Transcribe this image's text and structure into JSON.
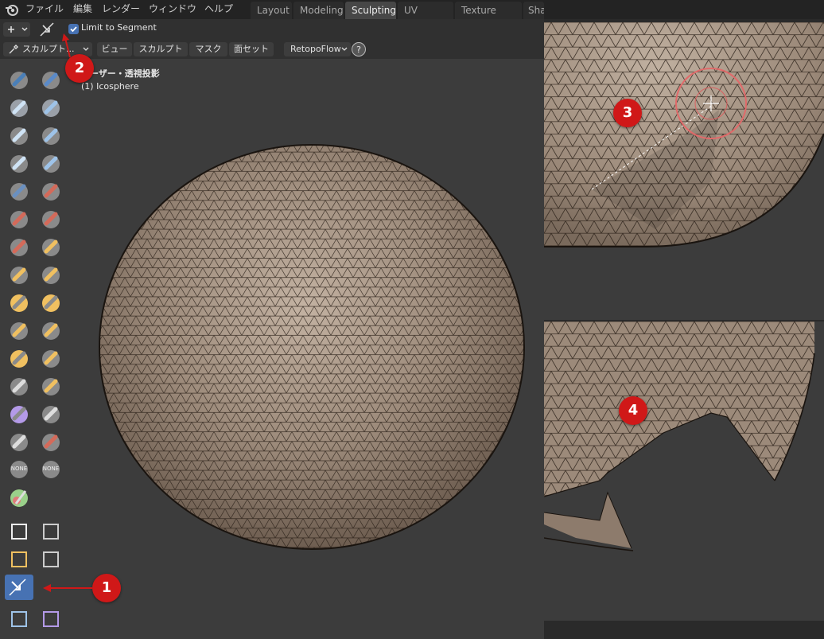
{
  "menu": {
    "file": "ファイル",
    "edit": "編集",
    "render": "レンダー",
    "window": "ウィンドウ",
    "help": "ヘルプ"
  },
  "workspaces": [
    "Layout",
    "Modeling",
    "Sculpting",
    "UV Editing",
    "Texture Paint",
    "Shad"
  ],
  "active_workspace": "Sculpting",
  "header": {
    "limit_label": "Limit to Segment",
    "limit_checked": true
  },
  "header2": {
    "mode": "スカルプト...",
    "view": "ビュー",
    "sculpt": "スカルプト",
    "mask": "マスク",
    "face_sets": "面セット",
    "retopoflow": "RetopoFlow",
    "help": "?"
  },
  "viewport": {
    "view_name": "ユーザー・透視投影",
    "object_name": "(1) Icosphere"
  },
  "toolshelf": {
    "none_label": "NONE"
  },
  "markers": [
    "1",
    "2",
    "3",
    "4"
  ],
  "colors": {
    "accent": "#4772b3",
    "marker": "#d01818",
    "sphere": "#9c8a7a"
  }
}
